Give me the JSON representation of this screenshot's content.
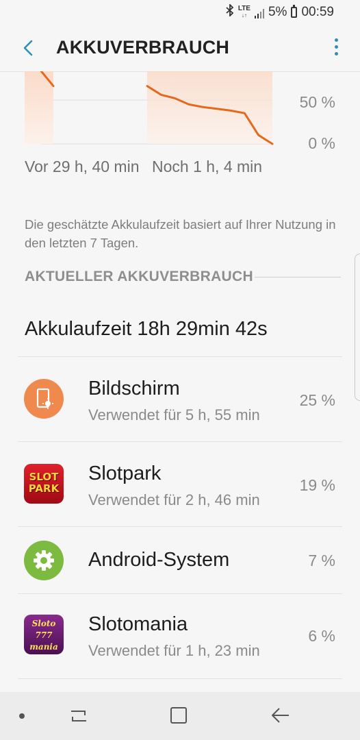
{
  "status_bar": {
    "bluetooth_icon": "bluetooth-icon",
    "network": "LTE",
    "signal_icon": "signal-icon",
    "battery_percent": "5%",
    "battery_icon": "battery-icon",
    "time": "00:59"
  },
  "header": {
    "back_icon": "back-arrow-icon",
    "title": "AKKUVERBRAUCH",
    "menu_icon": "more-vert-icon"
  },
  "chart_data": {
    "type": "line",
    "y_ticks": [
      "50 %",
      "0 %"
    ],
    "x_labels": [
      "Vor 29 h, 40 min",
      "Noch 1 h, 4 min"
    ],
    "series": [
      {
        "segment": "past",
        "color": "#e36a1c",
        "values": [
          85,
          66
        ]
      },
      {
        "segment": "recent",
        "color": "#e36a1c",
        "values": [
          66,
          56,
          52,
          45,
          42,
          40,
          38,
          35,
          10,
          0
        ]
      }
    ]
  },
  "info_text": "Die geschätzte Akkulaufzeit basiert auf Ihrer Nutzung in den letzten 7 Tagen.",
  "section_title": "AKTUELLER AKKUVERBRAUCH",
  "runtime": "Akkulaufzeit 18h 29min 42s",
  "apps": [
    {
      "name": "Bildschirm",
      "usage": "Verwendet für 5 h, 55 min",
      "percent": "25 %",
      "icon": "screen-brightness-icon",
      "color": "#f0894e"
    },
    {
      "name": "Slotpark",
      "usage": "Verwendet für 2 h, 46 min",
      "percent": "19 %",
      "icon": "slotpark-app-icon",
      "logo_text": "SLOT PARK",
      "color": "#c8101e"
    },
    {
      "name": "Android-System",
      "usage": "",
      "percent": "7 %",
      "icon": "gear-icon",
      "color": "#7cbb3f"
    },
    {
      "name": "Slotomania",
      "usage": "Verwendet für 1 h, 23 min",
      "percent": "6 %",
      "icon": "slotomania-app-icon",
      "logo_text": "Sloto 777 mania",
      "color": "#6a1c6e"
    }
  ],
  "nav_bar": {
    "dot_icon": "nav-dot-icon",
    "recents_icon": "recent-apps-icon",
    "home_icon": "home-icon",
    "back_icon": "nav-back-icon"
  }
}
